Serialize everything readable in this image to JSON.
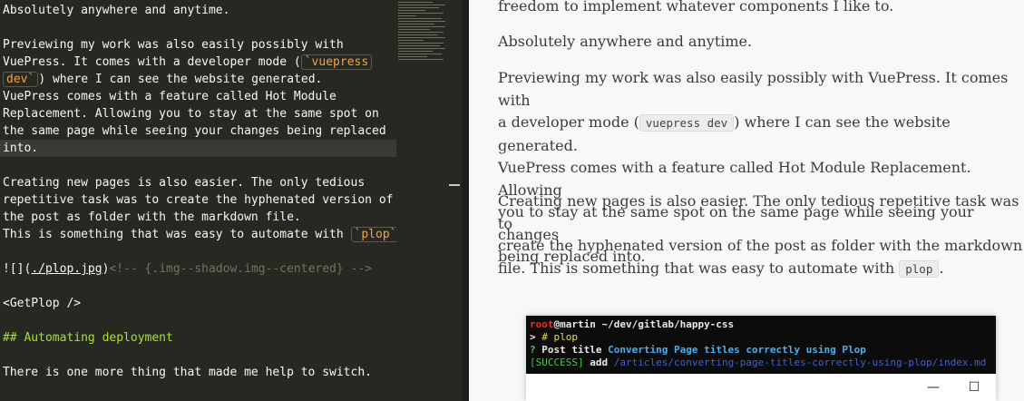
{
  "editor": {
    "line1": "Absolutely anywhere and anytime.",
    "line3": "Previewing my work was also easily possibly with",
    "line4_a": "VuePress. It comes with a developer mode (",
    "line4_code": "`vuepress",
    "line5_code": "dev`",
    "line5_b": ") where I can see the website generated.",
    "line6": "VuePress comes with a feature called Hot Module",
    "line7": "Replacement. Allowing you to stay at the same spot on",
    "line8": "the same page while seeing your changes being replaced",
    "line9": "into.",
    "line11": "Creating new pages is also easier. The only tedious",
    "line12": "repetitive task was to create the hyphenated version of",
    "line13": "the post as folder with the markdown file.",
    "line14_a": "This is something that was easy to automate with ",
    "line14_code": "`plop`",
    "line14_b": ".",
    "line16_a": "![](",
    "line16_link": "./plop.jpg",
    "line16_b": ")",
    "line16_comment": "<!-- {.img--shadow.img--centered} -->",
    "line18": "<GetPlop />",
    "line20": "## Automating deployment",
    "line22": "There is one more thing that made me help to switch."
  },
  "preview": {
    "p0": "freedom to implement whatever components I like to.",
    "p1": "Absolutely anywhere and anytime.",
    "p2_a": "Previewing my work was also easily possibly with VuePress. It comes with",
    "p2_b1": "a developer mode (",
    "p2_code": "vuepress dev",
    "p2_b2": ") where I can see the website generated.",
    "p2_c": "VuePress comes with a feature called Hot Module Replacement. Allowing",
    "p2_d": "you to stay at the same spot on the same page while seeing your changes",
    "p2_e": "being replaced into.",
    "p3_a": "Creating new pages is also easier. The only tedious repetitive task was to",
    "p3_b": "create the hyphenated version of the post as folder with the markdown",
    "p3_c1": "file. This is something that was easy to automate with ",
    "p3_code": "plop",
    "p3_c2": "."
  },
  "terminal": {
    "user": "root",
    "host_path": "@martin ~/dev/gitlab/happy-css",
    "prompt": "> ",
    "cmd": "# plop",
    "q_mark": "? ",
    "q_label": "Post title ",
    "q_answer": "Converting Page titles correctly using Plop",
    "success": "[SUCCESS]",
    "add": " add ",
    "path": "/articles/converting-page-titles-correctly-using-plop/index.md",
    "minimize": "—",
    "maximize": "☐"
  },
  "colors": {
    "editor_bg": "#272822",
    "accent_orange": "#f6a33c",
    "heading_green": "#a6e22e",
    "preview_bg": "#f8f8f8"
  }
}
